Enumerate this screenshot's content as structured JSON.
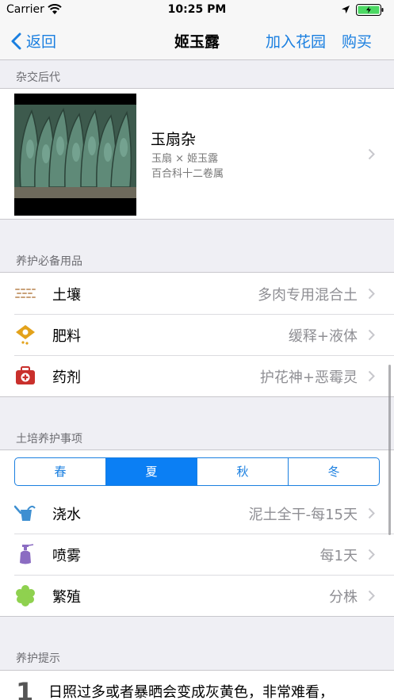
{
  "status_bar": {
    "carrier": "Carrier",
    "time": "10:25 PM"
  },
  "nav": {
    "back_label": "返回",
    "title": "姬玉露",
    "add_garden_label": "加入花园",
    "buy_label": "购买"
  },
  "hybrid": {
    "section_title": "杂交后代",
    "name": "玉扇杂",
    "parents": "玉扇 × 姬玉露",
    "family": "百合科十二卷属"
  },
  "supplies": {
    "section_title": "养护必备用品",
    "items": [
      {
        "icon": "soil-icon",
        "label": "土壤",
        "value": "多肉专用混合土"
      },
      {
        "icon": "fertilizer-icon",
        "label": "肥料",
        "value": "缓释+液体"
      },
      {
        "icon": "medicine-kit-icon",
        "label": "药剂",
        "value": "护花神+恶霉灵"
      }
    ]
  },
  "care": {
    "section_title": "土培养护事项",
    "seasons": [
      "春",
      "夏",
      "秋",
      "冬"
    ],
    "selected_season": "夏",
    "items": [
      {
        "icon": "watering-can-icon",
        "label": "浇水",
        "value": "泥土全干-每15天"
      },
      {
        "icon": "spray-bottle-icon",
        "label": "喷雾",
        "value": "每1天"
      },
      {
        "icon": "propagation-icon",
        "label": "繁殖",
        "value": "分株"
      }
    ]
  },
  "tips": {
    "section_title": "养护提示",
    "number": "1",
    "text": "日照过多或者暴晒会变成灰黄色，非常难看，"
  },
  "colors": {
    "accent": "#1a7fe0",
    "segment_active": "#0b7ff4",
    "background": "#efeff4"
  }
}
